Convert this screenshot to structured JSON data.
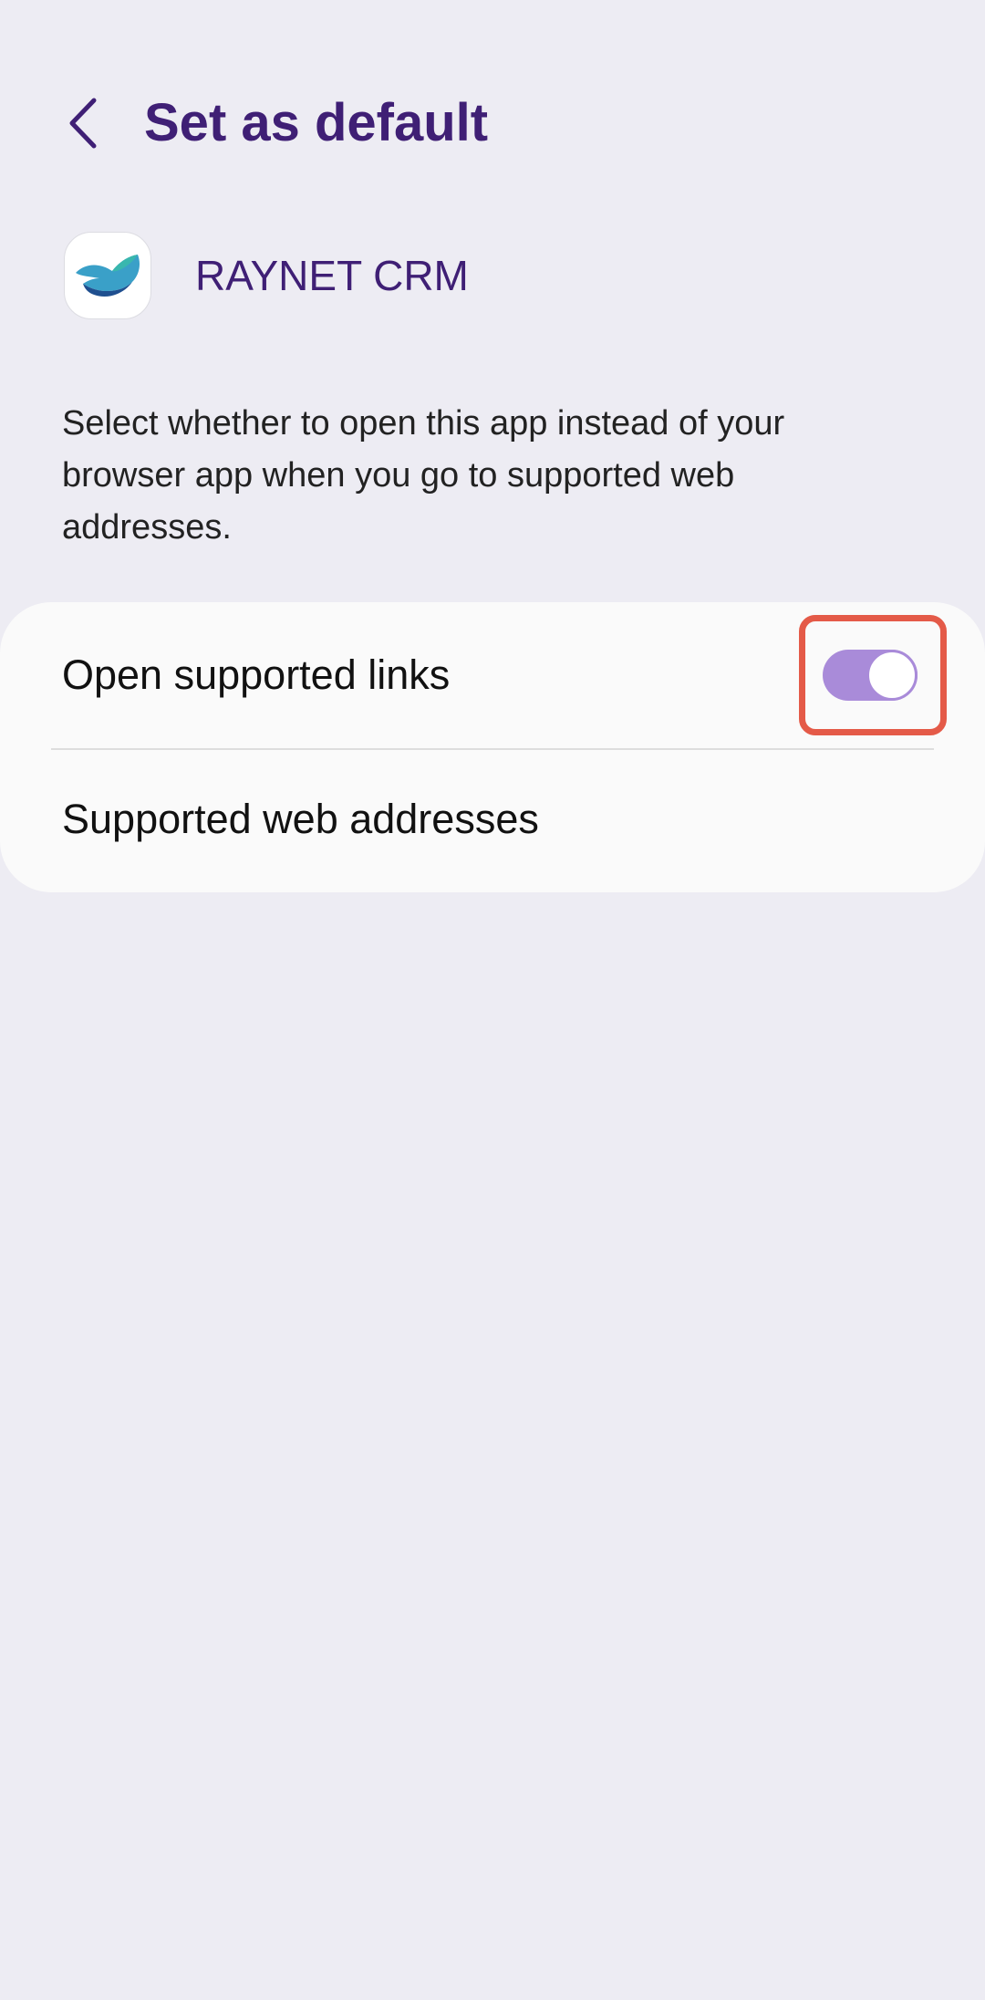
{
  "header": {
    "title": "Set as default",
    "back_icon": "chevron-left-icon"
  },
  "app": {
    "name": "RAYNET CRM",
    "icon": "raynet-logo-icon"
  },
  "description": "Select whether to open this app instead of your browser app when you go to supported web addresses.",
  "settings": {
    "open_links": {
      "label": "Open supported links",
      "enabled": true
    },
    "web_addresses": {
      "label": "Supported web addresses"
    }
  },
  "colors": {
    "accent": "#3f1f75",
    "toggle_on": "#a98bd9",
    "highlight": "#e45a48",
    "background": "#edecf3",
    "card": "#fafafa"
  }
}
